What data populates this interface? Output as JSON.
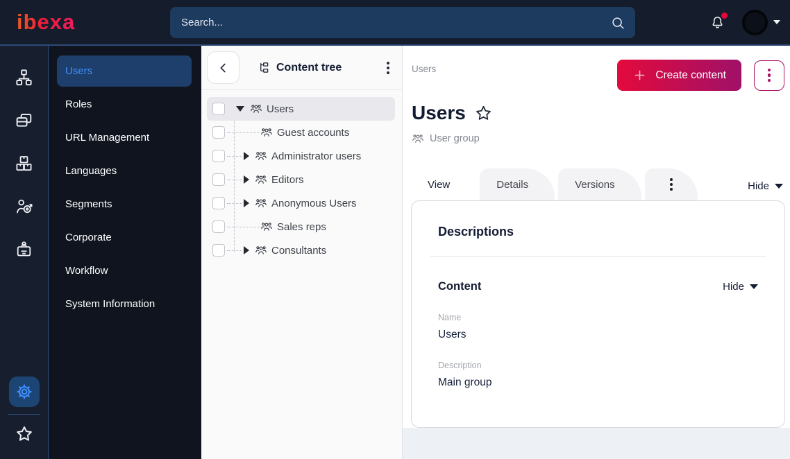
{
  "topbar": {
    "logo_text": "ibexa",
    "search_placeholder": "Search...",
    "icons": {
      "search": "magnifier",
      "notifications": "bell-with-red-dot",
      "account": "avatar-circle",
      "account_caret": "caret-down"
    }
  },
  "icon_rail": {
    "items": [
      {
        "icon": "sitemap-icon"
      },
      {
        "icon": "pages-icon"
      },
      {
        "icon": "product-boxes-icon"
      },
      {
        "icon": "personalization-target-icon"
      },
      {
        "icon": "corporate-badge-icon"
      }
    ],
    "bottom": [
      {
        "icon": "settings-gear-icon",
        "active": true
      },
      {
        "icon": "bookmarks-star-icon"
      }
    ]
  },
  "sidebar": {
    "items": [
      {
        "label": "Users",
        "selected": true
      },
      {
        "label": "Roles"
      },
      {
        "label": "URL Management"
      },
      {
        "label": "Languages"
      },
      {
        "label": "Segments"
      },
      {
        "label": "Corporate"
      },
      {
        "label": "Workflow"
      },
      {
        "label": "System Information"
      }
    ]
  },
  "content_tree": {
    "title": "Content tree",
    "items": [
      {
        "label": "Users",
        "state": "expanded",
        "selected": true
      },
      {
        "label": "Guest accounts",
        "state": "leaf"
      },
      {
        "label": "Administrator users",
        "state": "collapsed"
      },
      {
        "label": "Editors",
        "state": "collapsed"
      },
      {
        "label": "Anonymous Users",
        "state": "collapsed"
      },
      {
        "label": "Sales reps",
        "state": "leaf"
      },
      {
        "label": "Consultants",
        "state": "collapsed"
      }
    ]
  },
  "main": {
    "breadcrumb": "Users",
    "create_button_label": "Create content",
    "title": "Users",
    "content_type": "User group",
    "tabs": [
      {
        "label": "View",
        "active": true
      },
      {
        "label": "Details"
      },
      {
        "label": "Versions"
      }
    ],
    "hide_label": "Hide",
    "card": {
      "heading": "Descriptions",
      "section_title": "Content",
      "section_hide_label": "Hide",
      "fields": [
        {
          "label": "Name",
          "value": "Users"
        },
        {
          "label": "Description",
          "value": "Main group"
        }
      ]
    }
  },
  "colors": {
    "topbar_bg": "#151c2b",
    "accent_line": "#2d4b78",
    "rail_bg": "#171e2d",
    "sidebar_bg": "#0f141e",
    "selected_item_bg": "#1e3e6b",
    "accent_blue": "#4191ff",
    "primary_gradient_start": "#e30a3c",
    "primary_gradient_end": "#a01168",
    "notification_dot": "#e3073e",
    "tree_panel_bg": "#fafafa",
    "tab_inactive_bg": "#f3f3f5",
    "heading_text": "#131c33",
    "muted_text": "#878b95"
  }
}
